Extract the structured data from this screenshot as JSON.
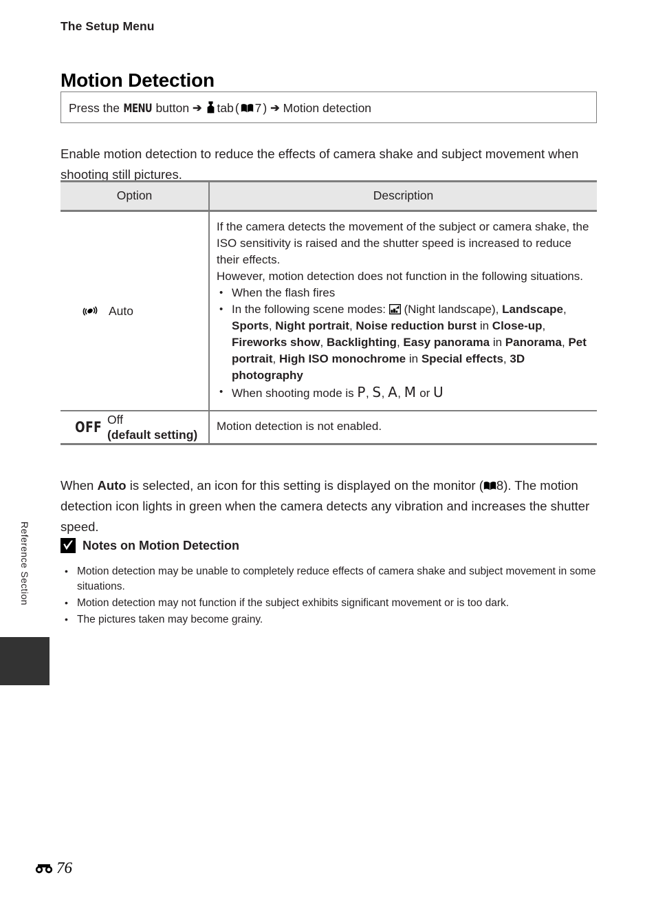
{
  "page": {
    "running_head": "The Setup Menu",
    "chapter_title": "Motion Detection",
    "side_tab_label": "Reference Section",
    "footer_icon": "reference-section-symbol",
    "footer_page_number": "76"
  },
  "nav_path": {
    "prefix": "Press the",
    "menu_button_glyph": "MENU",
    "button_word": "button",
    "arrow1": "➔",
    "setup_tab_icon": "wrench-icon",
    "tab_word": "tab",
    "ref_open": "(",
    "book_icon": "book-icon",
    "ref_page": "7",
    "ref_close": ")",
    "arrow2": "➔",
    "destination": "Motion detection"
  },
  "intro": {
    "text": "Enable motion detection to reduce the effects of camera shake and subject movement when shooting still pictures."
  },
  "table": {
    "headers": {
      "option": "Option",
      "description": "Description"
    },
    "rows": [
      {
        "icon": "motion-detection-icon",
        "label": "Auto",
        "description": {
          "para1": "If the camera detects the movement of the subject or camera shake, the ISO sensitivity is raised and the shutter speed is increased to reduce their effects.",
          "para2": "However, motion detection does not function in the following situations.",
          "bullets": [
            {
              "text": "When the flash fires"
            },
            {
              "lead": "In the following scene modes:",
              "night_icon": "night-landscape-icon",
              "night_label": "(Night landscape),",
              "bold_runs": [
                {
                  "bold": "Landscape",
                  "sep": ", "
                },
                {
                  "bold": "Sports",
                  "sep": ", "
                },
                {
                  "bold": "Night portrait",
                  "sep": ", "
                },
                {
                  "bold": "Noise reduction burst",
                  "sep": " "
                },
                {
                  "plain": "in ",
                  "bold": "Close-up",
                  "sep": ", "
                },
                {
                  "bold": "Fireworks show",
                  "sep": ", "
                },
                {
                  "bold": "Backlighting",
                  "sep": ", "
                },
                {
                  "bold": "Easy panorama",
                  "sep": " "
                },
                {
                  "plain": "in ",
                  "bold": "Panorama",
                  "sep": ", "
                },
                {
                  "bold": "Pet portrait",
                  "sep": ", "
                },
                {
                  "bold": "High ISO monochrome",
                  "sep": " "
                },
                {
                  "plain": "in ",
                  "bold": "Special effects",
                  "sep": ", "
                },
                {
                  "bold": "3D photography",
                  "sep": ""
                }
              ]
            },
            {
              "lead": "When shooting mode is",
              "modes": [
                "P",
                "S",
                "A",
                "M"
              ],
              "conjunction": "or",
              "last_mode": "U"
            }
          ]
        }
      },
      {
        "icon": "off-icon",
        "icon_glyph": "OFF",
        "label": "Off",
        "label_sub": "(default setting)",
        "description_simple": "Motion detection is not enabled."
      }
    ]
  },
  "after_table": {
    "part1": "When ",
    "bold1": "Auto",
    "part2": " is selected, an icon for this setting is displayed on the monitor (",
    "book_icon": "book-icon",
    "ref_page": "8",
    "part3": "). The motion detection icon lights in green when the camera detects any vibration and increases the shutter speed."
  },
  "notes": {
    "icon": "caution-check-icon",
    "title": "Notes on Motion Detection",
    "items": [
      "Motion detection may be unable to completely reduce effects of camera shake and subject movement in some situations.",
      "Motion detection may not function if the subject exhibits significant movement or is too dark.",
      "The pictures taken may become grainy."
    ]
  },
  "colors": {
    "text": "#231f20",
    "rule": "#7d7d7d",
    "header_fill": "#e7e7e7",
    "side_tab": "#333333"
  }
}
